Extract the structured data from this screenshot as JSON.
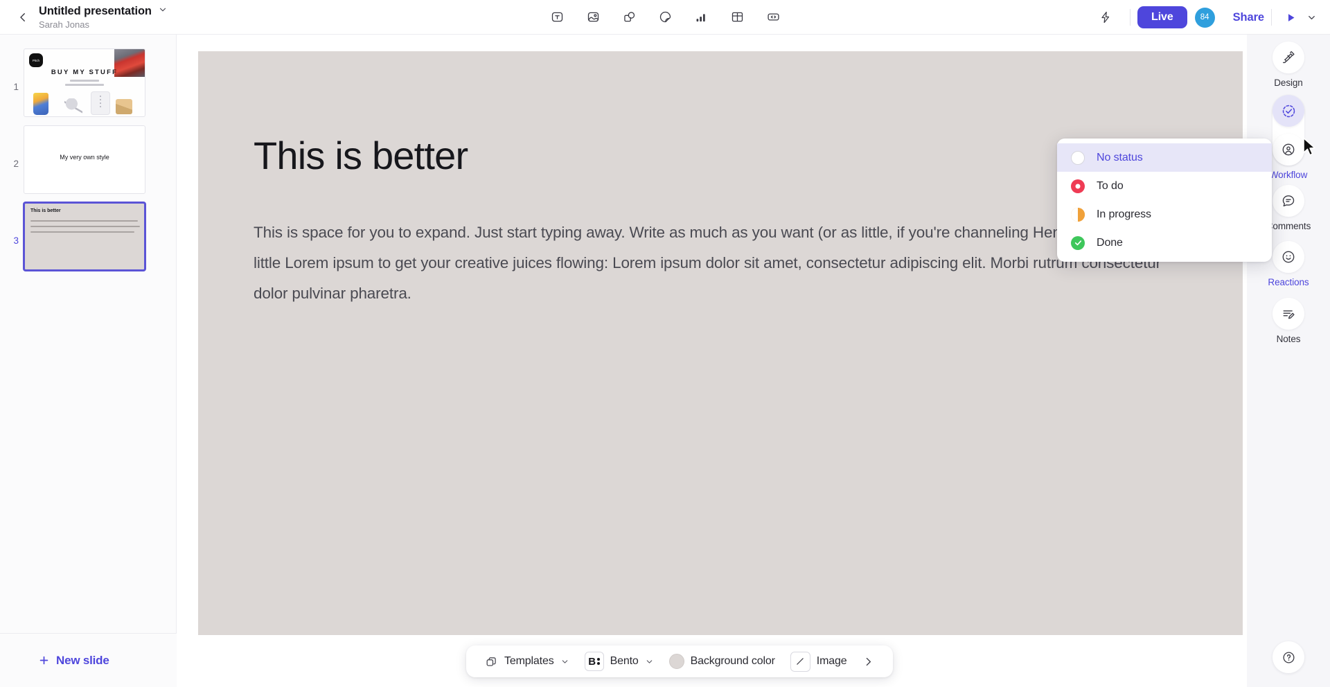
{
  "header": {
    "back_icon": "chevron-left-icon",
    "doc_title": "Untitled presentation",
    "doc_title_caret": "chevron-down-icon",
    "author": "Sarah Jonas",
    "tools": [
      {
        "name": "text-tool",
        "icon": "text-box-icon",
        "label": "Text"
      },
      {
        "name": "image-tool",
        "icon": "image-icon",
        "label": "Image"
      },
      {
        "name": "shapes-tool",
        "icon": "shapes-icon",
        "label": "Shapes"
      },
      {
        "name": "sticker-tool",
        "icon": "sticker-icon",
        "label": "Sticker"
      },
      {
        "name": "chart-tool",
        "icon": "bar-chart-icon",
        "label": "Chart"
      },
      {
        "name": "table-tool",
        "icon": "table-icon",
        "label": "Table"
      },
      {
        "name": "embed-tool",
        "icon": "code-embed-icon",
        "label": "Embed"
      }
    ],
    "flash_icon": "lightning-bolt-icon",
    "live_label": "Live",
    "avatar_count": "84",
    "share_label": "Share",
    "present_icon": "play-icon",
    "present_caret": "chevron-down-icon"
  },
  "sidebar": {
    "slides": [
      {
        "number": "1",
        "selected": false,
        "title": "BUY MY STUFF",
        "badge": "Pitch"
      },
      {
        "number": "2",
        "selected": false,
        "title": "My very own style"
      },
      {
        "number": "3",
        "selected": true,
        "title": "This is better"
      }
    ],
    "new_slide_label": "New slide",
    "new_slide_icon": "plus-icon"
  },
  "slide": {
    "title": "This is better",
    "body": "This is space for you to expand. Just start typing away. Write as much as you want (or as little, if you're channeling Hemingway). A little Lorem ipsum to get your creative juices flowing: Lorem ipsum dolor sit amet, consectetur adipiscing elit. Morbi rutrum consectetur dolor pulvinar pharetra.",
    "background_color": "#dcd7d5"
  },
  "status_menu": {
    "items": [
      {
        "label": "No status",
        "icon": "empty-circle-icon",
        "color": "#ffffff",
        "selected": true
      },
      {
        "label": "To do",
        "icon": "donut-circle-icon",
        "color": "#ef3b54",
        "selected": false
      },
      {
        "label": "In progress",
        "icon": "half-filled-circle-icon",
        "color": "#f0a13a",
        "selected": false
      },
      {
        "label": "Done",
        "icon": "check-circle-icon",
        "color": "#3ec75b",
        "selected": false
      }
    ]
  },
  "right_rail": {
    "items": [
      {
        "label": "Design",
        "icon": "design-brush-icon",
        "active": false
      },
      {
        "label": "Workflow",
        "icon": "workflow-check-icon",
        "active": true
      },
      {
        "label": "Comments",
        "icon": "comment-bubble-icon",
        "active": false
      },
      {
        "label": "Reactions",
        "icon": "smiley-face-icon",
        "active": true
      },
      {
        "label": "Notes",
        "icon": "notes-pencil-icon",
        "active": false
      }
    ],
    "presence_icon": "person-circle-icon",
    "help_icon": "question-mark-icon"
  },
  "bottom_bar": {
    "templates_label": "Templates",
    "templates_icon": "copy-stack-icon",
    "templates_caret": "chevron-down-icon",
    "style_label": "Bento",
    "style_icon": "bento-b-icon",
    "style_caret": "chevron-down-icon",
    "background_label": "Background color",
    "background_swatch": "#dcd7d5",
    "image_label": "Image",
    "image_icon": "diagonal-line-icon",
    "more_icon": "chevron-right-icon"
  },
  "theme": {
    "accent": "#4e46dc",
    "avatar_blue": "#2f9fdd"
  }
}
